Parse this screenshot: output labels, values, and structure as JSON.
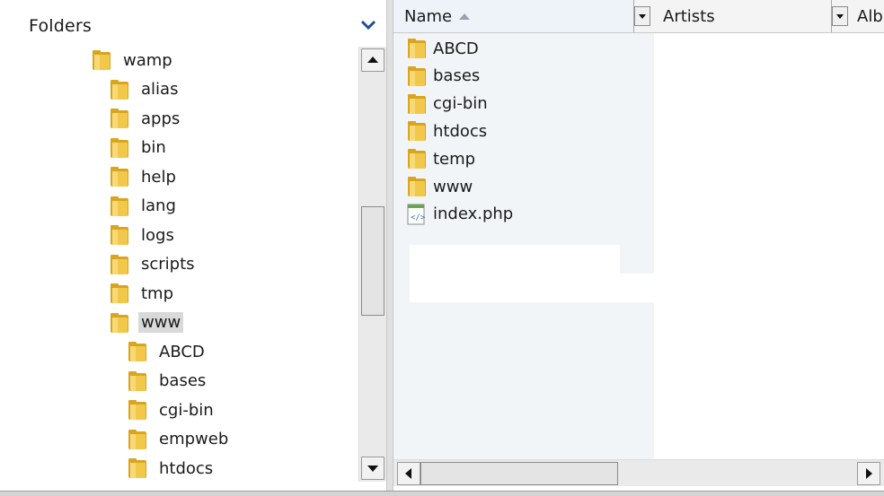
{
  "folders_pane": {
    "title": "Folders",
    "tree": [
      {
        "label": "wamp",
        "level": 0
      },
      {
        "label": "alias",
        "level": 1
      },
      {
        "label": "apps",
        "level": 1
      },
      {
        "label": "bin",
        "level": 1
      },
      {
        "label": "help",
        "level": 1
      },
      {
        "label": "lang",
        "level": 1
      },
      {
        "label": "logs",
        "level": 1
      },
      {
        "label": "scripts",
        "level": 1
      },
      {
        "label": "tmp",
        "level": 1
      },
      {
        "label": "www",
        "level": 1,
        "selected": true
      },
      {
        "label": "ABCD",
        "level": 2
      },
      {
        "label": "bases",
        "level": 2
      },
      {
        "label": "cgi-bin",
        "level": 2
      },
      {
        "label": "empweb",
        "level": 2
      },
      {
        "label": "htdocs",
        "level": 2
      }
    ]
  },
  "file_list": {
    "columns": [
      {
        "label": "Name",
        "sorted": "ascending"
      },
      {
        "label": "Artists"
      },
      {
        "label": "Alb"
      }
    ],
    "items": [
      {
        "label": "ABCD",
        "icon": "folder-icon"
      },
      {
        "label": "bases",
        "icon": "folder-icon"
      },
      {
        "label": "cgi-bin",
        "icon": "folder-icon"
      },
      {
        "label": "htdocs",
        "icon": "folder-icon"
      },
      {
        "label": "temp",
        "icon": "folder-icon"
      },
      {
        "label": "www",
        "icon": "folder-icon"
      },
      {
        "label": "index.php",
        "icon": "php-file-icon"
      }
    ]
  },
  "colors": {
    "folder": "#f2c84b",
    "folder_dark": "#d9a521",
    "selection": "#d9d9d9",
    "header_bg": "#f4f4f4",
    "name_column_bg": "#f2f5f8"
  }
}
